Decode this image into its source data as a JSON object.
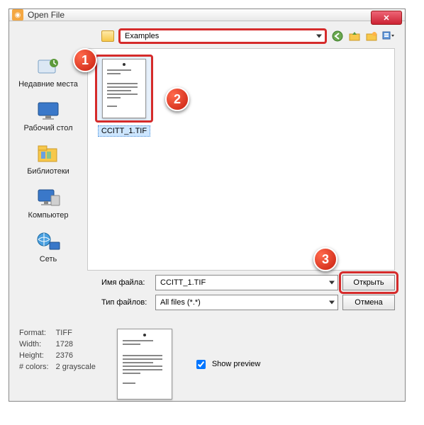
{
  "window": {
    "title": "Open File"
  },
  "toolbar": {
    "current_folder": "Examples",
    "back_icon": "back",
    "up_icon": "up-folder",
    "new_icon": "new-folder",
    "view_icon": "views"
  },
  "places": [
    {
      "label": "Недавние места"
    },
    {
      "label": "Рабочий стол"
    },
    {
      "label": "Библиотеки"
    },
    {
      "label": "Компьютер"
    },
    {
      "label": "Сеть"
    }
  ],
  "files": [
    {
      "name": "CCITT_1.TIF"
    }
  ],
  "fields": {
    "filename_label": "Имя файла:",
    "filename_value": "CCITT_1.TIF",
    "filetype_label": "Тип файлов:",
    "filetype_value": "All files (*.*)",
    "open_button": "Открыть",
    "cancel_button": "Отмена"
  },
  "info": {
    "format_label": "Format:",
    "format_value": "TIFF",
    "width_label": "Width:",
    "width_value": "1728",
    "height_label": "Height:",
    "height_value": "2376",
    "colors_label": "# colors:",
    "colors_value": "2 grayscale",
    "show_preview_label": "Show preview",
    "show_preview_checked": true
  },
  "badges": {
    "one": "1",
    "two": "2",
    "three": "3"
  }
}
